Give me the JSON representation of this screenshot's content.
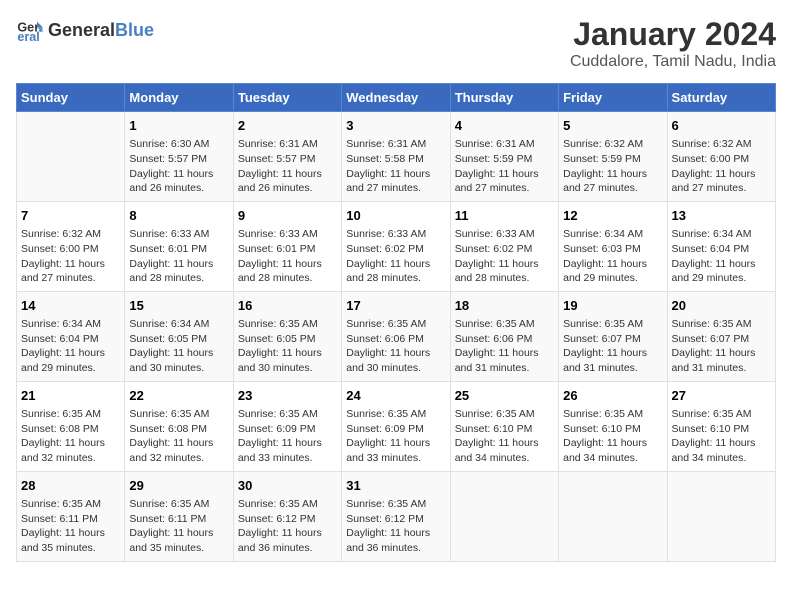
{
  "header": {
    "logo_general": "General",
    "logo_blue": "Blue",
    "title": "January 2024",
    "subtitle": "Cuddalore, Tamil Nadu, India"
  },
  "weekdays": [
    "Sunday",
    "Monday",
    "Tuesday",
    "Wednesday",
    "Thursday",
    "Friday",
    "Saturday"
  ],
  "weeks": [
    [
      {
        "day": "",
        "info": ""
      },
      {
        "day": "1",
        "info": "Sunrise: 6:30 AM\nSunset: 5:57 PM\nDaylight: 11 hours\nand 26 minutes."
      },
      {
        "day": "2",
        "info": "Sunrise: 6:31 AM\nSunset: 5:57 PM\nDaylight: 11 hours\nand 26 minutes."
      },
      {
        "day": "3",
        "info": "Sunrise: 6:31 AM\nSunset: 5:58 PM\nDaylight: 11 hours\nand 27 minutes."
      },
      {
        "day": "4",
        "info": "Sunrise: 6:31 AM\nSunset: 5:59 PM\nDaylight: 11 hours\nand 27 minutes."
      },
      {
        "day": "5",
        "info": "Sunrise: 6:32 AM\nSunset: 5:59 PM\nDaylight: 11 hours\nand 27 minutes."
      },
      {
        "day": "6",
        "info": "Sunrise: 6:32 AM\nSunset: 6:00 PM\nDaylight: 11 hours\nand 27 minutes."
      }
    ],
    [
      {
        "day": "7",
        "info": "Sunrise: 6:32 AM\nSunset: 6:00 PM\nDaylight: 11 hours\nand 27 minutes."
      },
      {
        "day": "8",
        "info": "Sunrise: 6:33 AM\nSunset: 6:01 PM\nDaylight: 11 hours\nand 28 minutes."
      },
      {
        "day": "9",
        "info": "Sunrise: 6:33 AM\nSunset: 6:01 PM\nDaylight: 11 hours\nand 28 minutes."
      },
      {
        "day": "10",
        "info": "Sunrise: 6:33 AM\nSunset: 6:02 PM\nDaylight: 11 hours\nand 28 minutes."
      },
      {
        "day": "11",
        "info": "Sunrise: 6:33 AM\nSunset: 6:02 PM\nDaylight: 11 hours\nand 28 minutes."
      },
      {
        "day": "12",
        "info": "Sunrise: 6:34 AM\nSunset: 6:03 PM\nDaylight: 11 hours\nand 29 minutes."
      },
      {
        "day": "13",
        "info": "Sunrise: 6:34 AM\nSunset: 6:04 PM\nDaylight: 11 hours\nand 29 minutes."
      }
    ],
    [
      {
        "day": "14",
        "info": "Sunrise: 6:34 AM\nSunset: 6:04 PM\nDaylight: 11 hours\nand 29 minutes."
      },
      {
        "day": "15",
        "info": "Sunrise: 6:34 AM\nSunset: 6:05 PM\nDaylight: 11 hours\nand 30 minutes."
      },
      {
        "day": "16",
        "info": "Sunrise: 6:35 AM\nSunset: 6:05 PM\nDaylight: 11 hours\nand 30 minutes."
      },
      {
        "day": "17",
        "info": "Sunrise: 6:35 AM\nSunset: 6:06 PM\nDaylight: 11 hours\nand 30 minutes."
      },
      {
        "day": "18",
        "info": "Sunrise: 6:35 AM\nSunset: 6:06 PM\nDaylight: 11 hours\nand 31 minutes."
      },
      {
        "day": "19",
        "info": "Sunrise: 6:35 AM\nSunset: 6:07 PM\nDaylight: 11 hours\nand 31 minutes."
      },
      {
        "day": "20",
        "info": "Sunrise: 6:35 AM\nSunset: 6:07 PM\nDaylight: 11 hours\nand 31 minutes."
      }
    ],
    [
      {
        "day": "21",
        "info": "Sunrise: 6:35 AM\nSunset: 6:08 PM\nDaylight: 11 hours\nand 32 minutes."
      },
      {
        "day": "22",
        "info": "Sunrise: 6:35 AM\nSunset: 6:08 PM\nDaylight: 11 hours\nand 32 minutes."
      },
      {
        "day": "23",
        "info": "Sunrise: 6:35 AM\nSunset: 6:09 PM\nDaylight: 11 hours\nand 33 minutes."
      },
      {
        "day": "24",
        "info": "Sunrise: 6:35 AM\nSunset: 6:09 PM\nDaylight: 11 hours\nand 33 minutes."
      },
      {
        "day": "25",
        "info": "Sunrise: 6:35 AM\nSunset: 6:10 PM\nDaylight: 11 hours\nand 34 minutes."
      },
      {
        "day": "26",
        "info": "Sunrise: 6:35 AM\nSunset: 6:10 PM\nDaylight: 11 hours\nand 34 minutes."
      },
      {
        "day": "27",
        "info": "Sunrise: 6:35 AM\nSunset: 6:10 PM\nDaylight: 11 hours\nand 34 minutes."
      }
    ],
    [
      {
        "day": "28",
        "info": "Sunrise: 6:35 AM\nSunset: 6:11 PM\nDaylight: 11 hours\nand 35 minutes."
      },
      {
        "day": "29",
        "info": "Sunrise: 6:35 AM\nSunset: 6:11 PM\nDaylight: 11 hours\nand 35 minutes."
      },
      {
        "day": "30",
        "info": "Sunrise: 6:35 AM\nSunset: 6:12 PM\nDaylight: 11 hours\nand 36 minutes."
      },
      {
        "day": "31",
        "info": "Sunrise: 6:35 AM\nSunset: 6:12 PM\nDaylight: 11 hours\nand 36 minutes."
      },
      {
        "day": "",
        "info": ""
      },
      {
        "day": "",
        "info": ""
      },
      {
        "day": "",
        "info": ""
      }
    ]
  ]
}
